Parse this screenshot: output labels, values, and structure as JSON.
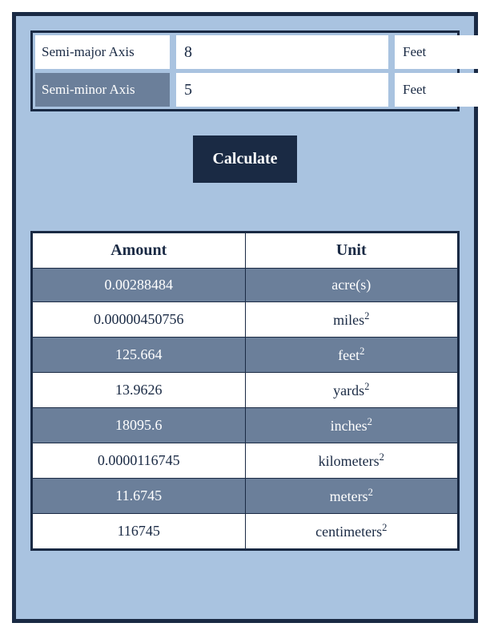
{
  "inputs": {
    "row1": {
      "label": "Semi-major Axis",
      "value": "8",
      "unit": "Feet"
    },
    "row2": {
      "label": "Semi-minor Axis",
      "value": "5",
      "unit": "Feet"
    }
  },
  "buttons": {
    "calculate": "Calculate"
  },
  "results": {
    "headers": {
      "amount": "Amount",
      "unit": "Unit"
    },
    "rows": [
      {
        "amount": "0.00288484",
        "unit": "acre(s)",
        "sup": ""
      },
      {
        "amount": "0.00000450756",
        "unit": "miles",
        "sup": "2"
      },
      {
        "amount": "125.664",
        "unit": "feet",
        "sup": "2"
      },
      {
        "amount": "13.9626",
        "unit": "yards",
        "sup": "2"
      },
      {
        "amount": "18095.6",
        "unit": "inches",
        "sup": "2"
      },
      {
        "amount": "0.0000116745",
        "unit": "kilometers",
        "sup": "2"
      },
      {
        "amount": "11.6745",
        "unit": "meters",
        "sup": "2"
      },
      {
        "amount": "116745",
        "unit": "centimeters",
        "sup": "2"
      }
    ]
  }
}
